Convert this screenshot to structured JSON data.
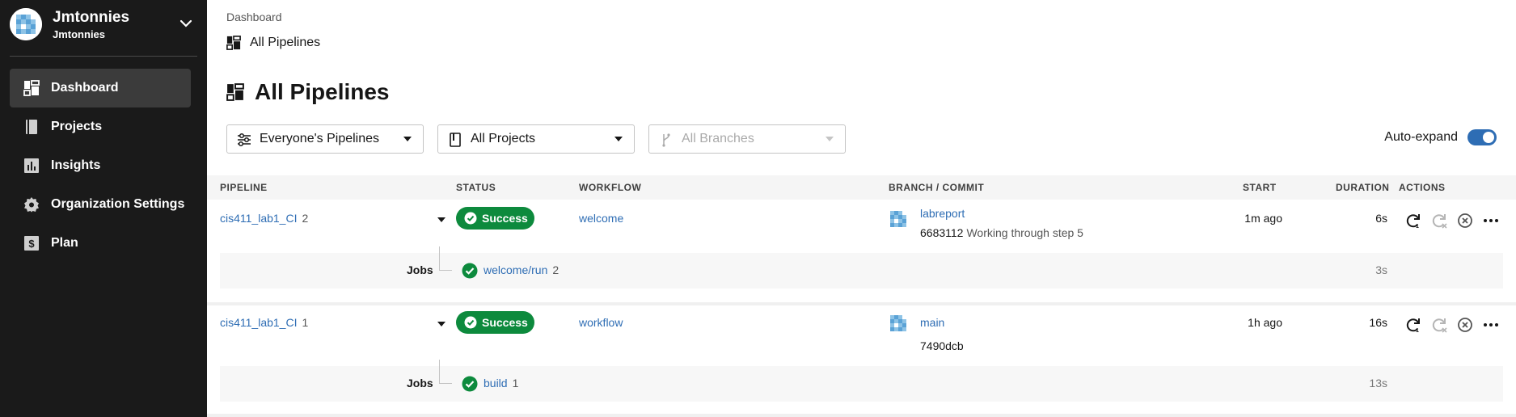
{
  "org": {
    "name": "Jmtonnies",
    "subname": "Jmtonnies"
  },
  "nav": [
    {
      "label": "Dashboard",
      "icon": "dashboard-icon",
      "active": true
    },
    {
      "label": "Projects",
      "icon": "book-icon"
    },
    {
      "label": "Insights",
      "icon": "chart-icon"
    },
    {
      "label": "Organization Settings",
      "icon": "gear-icon"
    },
    {
      "label": "Plan",
      "icon": "dollar-icon"
    }
  ],
  "breadcrumb": {
    "parent": "Dashboard",
    "current": "All Pipelines"
  },
  "page": {
    "title": "All Pipelines"
  },
  "filters": {
    "pipelines": "Everyone's Pipelines",
    "projects": "All Projects",
    "branches": "All Branches"
  },
  "autoexpand": {
    "label": "Auto-expand",
    "enabled": true
  },
  "table": {
    "headers": {
      "pipeline": "PIPELINE",
      "status": "STATUS",
      "workflow": "WORKFLOW",
      "branch": "BRANCH / COMMIT",
      "start": "START",
      "duration": "DURATION",
      "actions": "ACTIONS"
    },
    "rows": [
      {
        "pipeline": "cis411_lab1_CI",
        "number": "2",
        "status": "Success",
        "workflow": "welcome",
        "branch": "labreport",
        "sha": "6683112",
        "message": "Working through step 5",
        "start": "1m ago",
        "duration": "6s",
        "jobs_label": "Jobs",
        "job": {
          "name": "welcome/run",
          "number": "2",
          "duration": "3s"
        }
      },
      {
        "pipeline": "cis411_lab1_CI",
        "number": "1",
        "status": "Success",
        "workflow": "workflow",
        "branch": "main",
        "sha": "7490dcb",
        "message": "",
        "start": "1h ago",
        "duration": "16s",
        "jobs_label": "Jobs",
        "job": {
          "name": "build",
          "number": "1",
          "duration": "13s"
        }
      }
    ]
  },
  "colors": {
    "sidebar": "#1a1a1a",
    "accent": "#2e6db4",
    "success": "#0d8a3d",
    "header_bg": "#f5f5f5"
  }
}
